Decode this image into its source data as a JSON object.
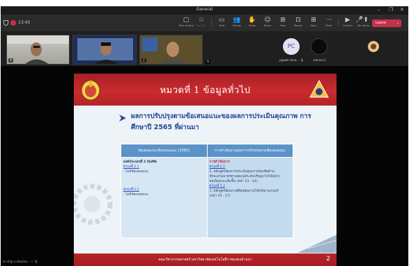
{
  "window": {
    "title": "General",
    "minimize": "–",
    "restore": "❐",
    "close": "✕"
  },
  "toolbar": {
    "timer": "13:45",
    "buttons": [
      {
        "label": "Take control",
        "icon": "▢"
      },
      {
        "label": "Pop out",
        "icon": "⧉"
      },
      {
        "label": "Chat",
        "icon": "▭"
      },
      {
        "label": "People",
        "icon": "👥"
      },
      {
        "label": "Raise",
        "icon": "✋"
      },
      {
        "label": "React",
        "icon": "☺"
      },
      {
        "label": "View",
        "icon": "⊞"
      },
      {
        "label": "Rooms",
        "icon": "⊡"
      },
      {
        "label": "Apps",
        "icon": "⊞"
      },
      {
        "label": "More",
        "icon": "···"
      },
      {
        "label": "Camera",
        "icon": "▶"
      },
      {
        "label": "Mic",
        "icon": "🎤"
      },
      {
        "label": "Share",
        "icon": "⬆"
      }
    ],
    "leave_label": "Leave",
    "leave_chevron": "⌄"
  },
  "participants": {
    "badges": [
      "A",
      "",
      "J",
      "S"
    ],
    "pc_initials": "PC",
    "pc_name": "pppwt chua... 🎙",
    "cam_name": "kanna U"
  },
  "slide": {
    "title": "หมวดที่ 1 ข้อมูลทั่วไป",
    "subtitle": "ผลการปรับปรุงตามข้อเสนอแนะของผลการประเมินคุณภาพ การศึกษาปี 2565 ที่ผ่านมา",
    "table": {
      "headers": [
        "ข้อเสนอแนะ/ข้อเสนอแนะ (2565)",
        "การดำเนินงาน/ผลการปรับปรุงตามข้อเสนอแนะ"
      ],
      "left": {
        "component": "องค์ประกอบที่ 2",
        "component_name": "บัณฑิต",
        "item1": "ตัวบ่งชี้ 2.1",
        "item1_note": "- ไม่มีข้อเสนอแนะ",
        "item2": "ตัวบ่งชี้ 2.2",
        "item2_note": "- ไม่มีข้อเสนอแนะ"
      },
      "right": {
        "heading": "การดำเนินการ",
        "item1": "ตัวบ่งชี้ 2.1",
        "item1_lines": [
          "1. หลักสูตรมีผลการประเมินคุณภาพบัณฑิตด้าน",
          "ทักษะตามมาตรฐานคุณวุฒิระดับปริญญาโทได้อย่าง",
          "ต่อเนื่องและเพิ่มขึ้น (หน้า 23 - 24)"
        ],
        "item2": "ตัวบ่งชี้ 2.2",
        "item2_lines": [
          "1. หลักสูตรมีผลงานตีพิมพ์ผลงานวิจัยได้ตามเกณฑ์",
          "(หน้า 25 - 27)"
        ]
      }
    },
    "footer": "คณะวิศวกรรมศาสตร์ มหาวิทยาลัยเทคโนโลยีราชมงคลล้านนา",
    "page": "2"
  },
  "presenter_label": "sc.chip s.chucha... ― 🎙"
}
